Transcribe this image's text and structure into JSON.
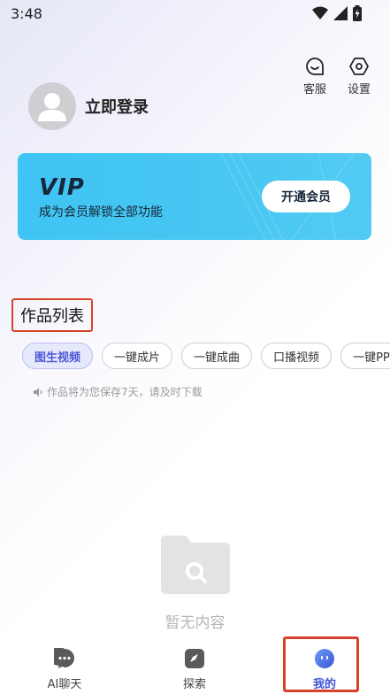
{
  "status_bar": {
    "time": "3:48",
    "icons": [
      "wifi-icon",
      "signal-icon",
      "battery-charging-icon"
    ]
  },
  "top_actions": [
    {
      "label": "客服",
      "icon": "customer-service-icon"
    },
    {
      "label": "设置",
      "icon": "settings-gear-icon"
    }
  ],
  "profile": {
    "login_text": "立即登录",
    "avatar_icon": "avatar-placeholder-icon"
  },
  "vip_card": {
    "logo": "VIP",
    "description": "成为会员解锁全部功能",
    "button_label": "开通会员",
    "color": "#43c5f3"
  },
  "works": {
    "title": "作品列表",
    "filters": [
      {
        "label": "图生视频",
        "active": true
      },
      {
        "label": "一键成片",
        "active": false
      },
      {
        "label": "一键成曲",
        "active": false
      },
      {
        "label": "口播视频",
        "active": false
      },
      {
        "label": "一键PPT",
        "active": false
      }
    ],
    "notice": "作品将为您保存7天，请及时下载",
    "empty_text": "暂无内容"
  },
  "tab_bar": {
    "tabs": [
      {
        "label": "AI聊天",
        "icon": "chat-bubble-icon",
        "active": false
      },
      {
        "label": "探索",
        "icon": "compass-icon",
        "active": false
      },
      {
        "label": "我的",
        "icon": "profile-face-icon",
        "active": true
      }
    ]
  },
  "colors": {
    "accent": "#3d55d6",
    "highlight_border": "#d9412b"
  }
}
